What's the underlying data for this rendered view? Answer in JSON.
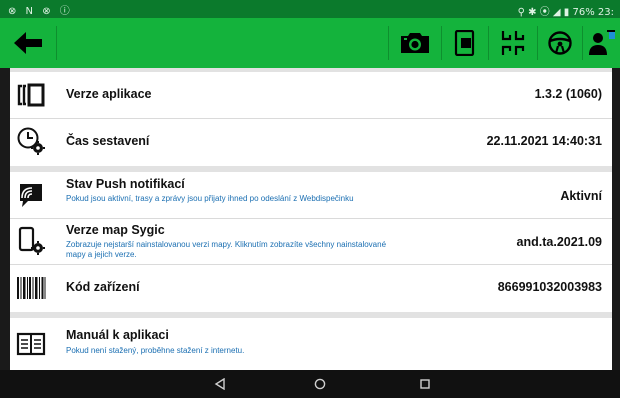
{
  "status_bar": {
    "left_icons_text": "⊗ N ⊗ ⓘ",
    "right_icons_text": "⚲ ✱ ⦿ ◢ ▮",
    "battery": "76%",
    "time": "23:"
  },
  "toolbar": {
    "back_icon": "arrow-left-icon",
    "buttons": [
      "camera-icon",
      "document-icon",
      "apps-grid-icon",
      "steering-wheel-icon",
      "user-switch-icon"
    ]
  },
  "rows": [
    {
      "id": "app-version",
      "icon": "app-version-icon",
      "title": "Verze aplikace",
      "description": "",
      "value": "1.3.2 (1060)"
    },
    {
      "id": "build-time",
      "icon": "clock-gear-icon",
      "title": "Čas sestavení",
      "description": "",
      "value": "22.11.2021 14:40:31"
    },
    {
      "id": "push-status",
      "icon": "signal-chat-icon",
      "title": "Stav Push notifikací",
      "description": "Pokud jsou aktivní, trasy a zprávy jsou přijaty ihned po odeslání z Webdispečinku",
      "value": "Aktivní"
    },
    {
      "id": "sygic-version",
      "icon": "phone-gear-icon",
      "title": "Verze map Sygic",
      "description": "Zobrazuje nejstarší nainstalovanou verzi mapy. Kliknutím zobrazíte všechny nainstalované mapy a jejich verze.",
      "value": "and.ta.2021.09"
    },
    {
      "id": "device-code",
      "icon": "barcode-icon",
      "title": "Kód zařízení",
      "description": "",
      "value": "866991032003983"
    },
    {
      "id": "manual",
      "icon": "book-icon",
      "title": "Manuál k aplikaci",
      "description": "Pokud není stažený, proběhne stažení z internetu.",
      "value": ""
    }
  ],
  "nav_bar": {
    "buttons": [
      "nav-back-icon",
      "nav-home-icon",
      "nav-recents-icon"
    ]
  },
  "colors": {
    "toolbar_green": "#14b33c",
    "status_green": "#0b7a2c",
    "description_blue": "#1b6fb2"
  }
}
